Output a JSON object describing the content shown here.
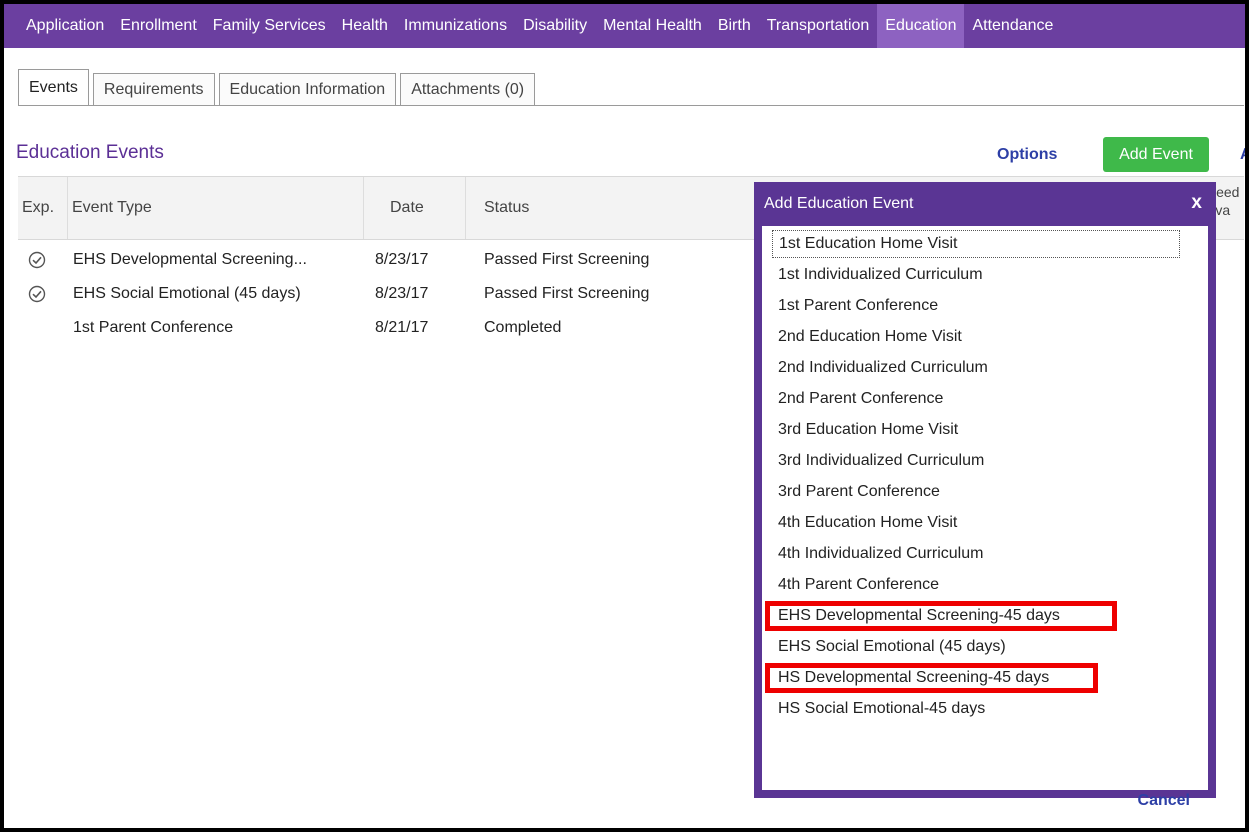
{
  "topnav": {
    "items": [
      {
        "label": "Application"
      },
      {
        "label": "Enrollment"
      },
      {
        "label": "Family Services"
      },
      {
        "label": "Health"
      },
      {
        "label": "Immunizations"
      },
      {
        "label": "Disability"
      },
      {
        "label": "Mental Health"
      },
      {
        "label": "Birth"
      },
      {
        "label": "Transportation"
      },
      {
        "label": "Education"
      },
      {
        "label": "Attendance"
      }
    ],
    "active": "Education"
  },
  "tabs": [
    {
      "label": "Events"
    },
    {
      "label": "Requirements"
    },
    {
      "label": "Education Information"
    },
    {
      "label": "Attachments (0)"
    }
  ],
  "section": {
    "title": "Education Events",
    "options_label": "Options",
    "add_event_label": "Add Event",
    "edge_glyph": "A"
  },
  "grid": {
    "headers": {
      "exp": "Exp.",
      "event_type": "Event Type",
      "date": "Date",
      "status": "Status",
      "need_1": "Need",
      "need_2": "Eva"
    },
    "rows": [
      {
        "checked": true,
        "event_type": "EHS Developmental Screening...",
        "date": "8/23/17",
        "status": "Passed First Screening"
      },
      {
        "checked": true,
        "event_type": "EHS Social Emotional (45 days)",
        "date": "8/23/17",
        "status": "Passed First Screening"
      },
      {
        "checked": false,
        "event_type": "1st Parent Conference",
        "date": "8/21/17",
        "status": "Completed"
      }
    ]
  },
  "popup": {
    "title": "Add Education Event",
    "close_glyph": "x",
    "options": [
      "1st Education Home Visit",
      "1st Individualized Curriculum",
      "1st Parent Conference",
      "2nd Education Home Visit",
      "2nd Individualized Curriculum",
      "2nd Parent Conference",
      "3rd Education Home Visit",
      "3rd Individualized Curriculum",
      "3rd Parent Conference",
      "4th Education Home Visit",
      "4th Individualized Curriculum",
      "4th Parent Conference",
      "EHS Developmental Screening-45 days",
      "EHS Social Emotional (45 days)",
      "HS Developmental Screening-45 days",
      "HS Social Emotional-45 days"
    ],
    "highlighted": [
      "EHS Developmental Screening-45 days",
      "HS Developmental Screening-45 days"
    ],
    "highlight_color": "#ee0000",
    "cancel_label": "Cancel"
  },
  "colors": {
    "nav_bg": "#6b3fa0",
    "popup_bg": "#5a3594",
    "accent_green": "#3fb94a",
    "link_blue": "#2d3fa6",
    "title_purple": "#5b2f95"
  }
}
